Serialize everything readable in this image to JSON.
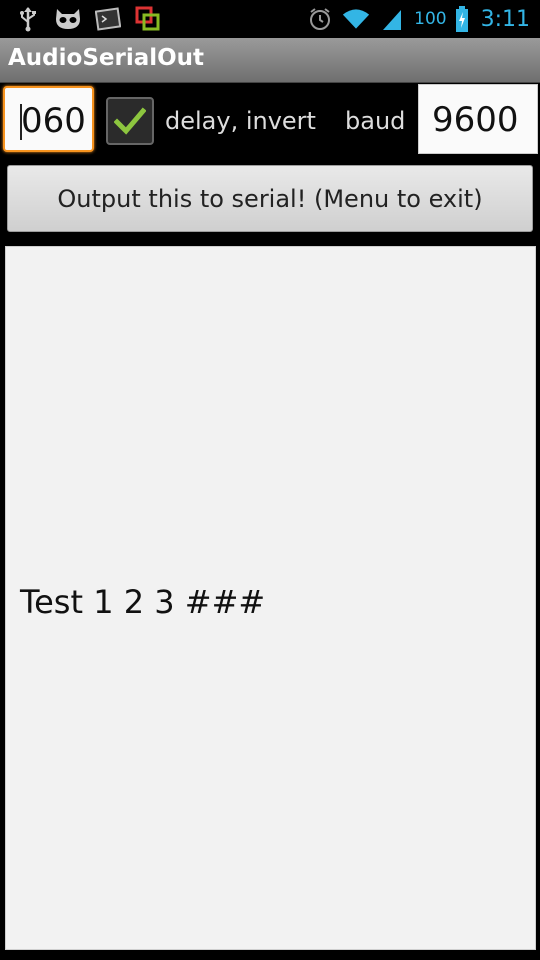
{
  "status_bar": {
    "left_icons": [
      "usb-icon",
      "cyanogen-mascot-icon",
      "terminal-icon",
      "screen-share-icon"
    ],
    "right_icons": [
      "alarm-icon",
      "wifi-icon",
      "signal-icon",
      "battery-charging-icon"
    ],
    "battery_level": "100",
    "clock": "3:11",
    "accent_color": "#33b5e5"
  },
  "app": {
    "title": "AudioSerialOut"
  },
  "controls": {
    "delay_value": "060",
    "checkbox_checked": true,
    "checkbox_label": "delay, invert",
    "baud_label": "baud",
    "baud_value": "9600",
    "focus_color": "#f7931e",
    "check_color": "#8dc63f"
  },
  "output_button": {
    "label": "Output this to serial! (Menu to exit)"
  },
  "message": {
    "text": "Test 1 2 3 ###"
  }
}
